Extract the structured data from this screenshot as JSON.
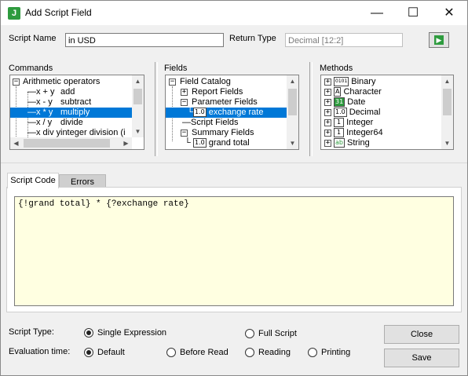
{
  "window": {
    "title": "Add Script Field",
    "app_icon_letter": "J"
  },
  "header": {
    "script_name_label": "Script Name",
    "script_name_value": "in USD",
    "return_type_label": "Return Type",
    "return_type_value": "Decimal [12:2]"
  },
  "commands": {
    "label": "Commands",
    "items": [
      {
        "sym": "",
        "text": "Arithmetic operators"
      },
      {
        "sym": "x + y",
        "text": "add"
      },
      {
        "sym": "x - y",
        "text": "subtract"
      },
      {
        "sym": "x * y",
        "text": "multiply"
      },
      {
        "sym": "x / y",
        "text": "divide"
      },
      {
        "sym": "x div y",
        "text": "integer division (i"
      }
    ]
  },
  "fields": {
    "label": "Fields",
    "items": [
      {
        "text": "Field Catalog",
        "tag": ""
      },
      {
        "text": "Report Fields",
        "tag": ""
      },
      {
        "text": "Parameter Fields",
        "tag": ""
      },
      {
        "text": "exchange rate",
        "tag": "1.0"
      },
      {
        "text": "Script Fields",
        "tag": ""
      },
      {
        "text": "Summary Fields",
        "tag": ""
      },
      {
        "text": "grand total",
        "tag": "1.0"
      }
    ]
  },
  "methods": {
    "label": "Methods",
    "items": [
      {
        "text": "Binary",
        "tag": "0101"
      },
      {
        "text": "Character",
        "tag": "A"
      },
      {
        "text": "Date",
        "tag": "31"
      },
      {
        "text": "Decimal",
        "tag": "1.0"
      },
      {
        "text": "Integer",
        "tag": "1"
      },
      {
        "text": "Integer64",
        "tag": "1"
      },
      {
        "text": "String",
        "tag": "ab"
      }
    ]
  },
  "tabs": {
    "script_code": "Script Code",
    "errors": "Errors"
  },
  "code": "{!grand total} * {?exchange rate}",
  "options": {
    "script_type_label": "Script Type:",
    "single_expression": "Single Expression",
    "full_script": "Full Script",
    "evaluation_label": "Evaluation time:",
    "default": "Default",
    "before_read": "Before Read",
    "reading": "Reading",
    "printing": "Printing"
  },
  "buttons": {
    "close": "Close",
    "save": "Save"
  },
  "colors": {
    "selection": "#0078d7",
    "code_bg": "#ffffe1",
    "app_icon": "#2e9b3e"
  }
}
